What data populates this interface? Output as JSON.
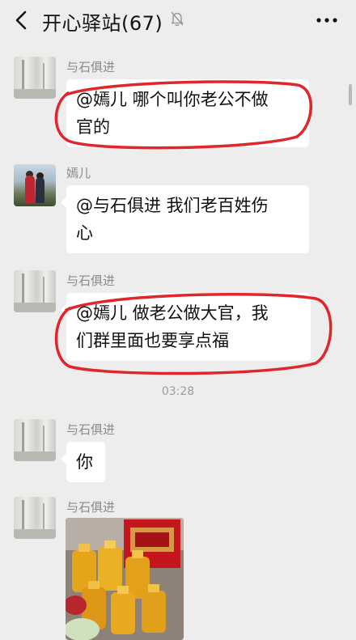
{
  "header": {
    "title": "开心驿站(67)",
    "back_icon": "chevron-left-icon",
    "mute_icon": "bell-muted-icon",
    "more_icon": "more-dots-icon"
  },
  "messages": [
    {
      "sender": "与石俱进",
      "lines": [
        "@嫣儿  哪个叫你老公不做",
        "官的"
      ],
      "highlighted": true
    },
    {
      "sender": "嫣儿",
      "lines": [
        "@与石俱进  我们老百姓伤",
        "心"
      ],
      "highlighted": false
    },
    {
      "sender": "与石俱进",
      "lines": [
        "@嫣儿  做老公做大官，我",
        "们群里面也要享点福"
      ],
      "highlighted": true
    },
    {
      "sender": "与石俱进",
      "lines": [
        "你"
      ],
      "highlighted": false
    },
    {
      "sender": "与石俱进",
      "type": "photo",
      "highlighted": false
    }
  ],
  "timestamp": "03:28",
  "colors": {
    "background": "#ededed",
    "bubble": "#ffffff",
    "annotation_red": "#e0262b"
  }
}
